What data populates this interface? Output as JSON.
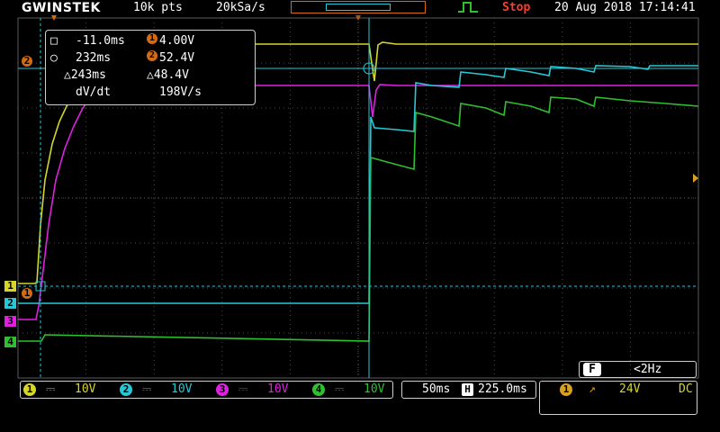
{
  "header": {
    "brand": "GWINSTEK",
    "record_length": "10k pts",
    "sample_rate": "20kSa/s",
    "run_state": "Stop",
    "date_time": "20 Aug 2018 17:14:41"
  },
  "measurement": {
    "cursor1_time": "-11.0ms",
    "cursor1_value": "4.00V",
    "cursor2_time": "232ms",
    "cursor2_value": "52.4V",
    "delta_time": "△243ms",
    "delta_value": "△48.4V",
    "rate_label": "dV/dt",
    "rate_value": "198V/s"
  },
  "channels": [
    {
      "num": "1",
      "coupling": "⎓",
      "scale": "10V",
      "color": "#d6d62a"
    },
    {
      "num": "2",
      "coupling": "⎓",
      "scale": "10V",
      "color": "#27c8d6"
    },
    {
      "num": "3",
      "coupling": "⎓",
      "scale": "10V",
      "color": "#e020e0"
    },
    {
      "num": "4",
      "coupling": "⎓",
      "scale": "10V",
      "color": "#2fc02f"
    }
  ],
  "timebase": {
    "scale": "50ms",
    "h_label": "H",
    "position": "225.0ms"
  },
  "trigger": {
    "source": "1",
    "slope": "↗",
    "level": "24V",
    "coupling": "DC"
  },
  "frequency": {
    "label": "F",
    "value": "<2Hz"
  },
  "colors": {
    "accent": "#d46a12",
    "grid": "#3a3a3a",
    "cursor": "#27c8d6"
  }
}
